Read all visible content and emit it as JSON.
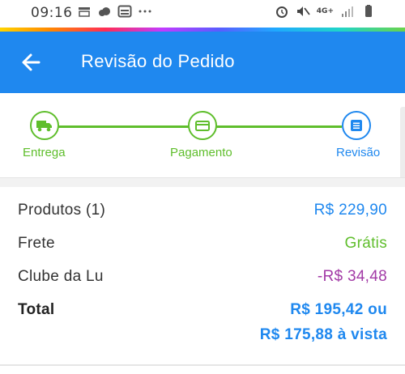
{
  "status_bar": {
    "time": "09:16",
    "network": "4G+",
    "left_icons": [
      "marketplace-icon",
      "cloud-icon",
      "calendar-icon",
      "more-dots-icon"
    ],
    "right_icons": [
      "alarm-icon",
      "mute-icon",
      "signal-icon",
      "battery-icon"
    ]
  },
  "header": {
    "title": "Revisão do Pedido",
    "back_icon": "arrow-left-icon",
    "color": "#1f88ef"
  },
  "stepper": {
    "steps": [
      {
        "label": "Entrega",
        "icon": "truck-icon",
        "state": "completed",
        "color": "#5fbe2c"
      },
      {
        "label": "Pagamento",
        "icon": "card-icon",
        "state": "completed",
        "color": "#5fbe2c"
      },
      {
        "label": "Revisão",
        "icon": "list-icon",
        "state": "current",
        "color": "#1f88ef"
      }
    ]
  },
  "summary": {
    "products_label": "Produtos (1)",
    "products_value": "R$ 229,90",
    "shipping_label": "Frete",
    "shipping_value": "Grátis",
    "club_label": "Clube da Lu",
    "club_value": "-R$ 34,48",
    "total_label": "Total",
    "total_value": "R$ 195,42 ou",
    "total_cash_value": "R$ 175,88 à vista",
    "colors": {
      "price": "#1f88ef",
      "free": "#5fbe2c",
      "discount": "#a23aa6"
    }
  }
}
